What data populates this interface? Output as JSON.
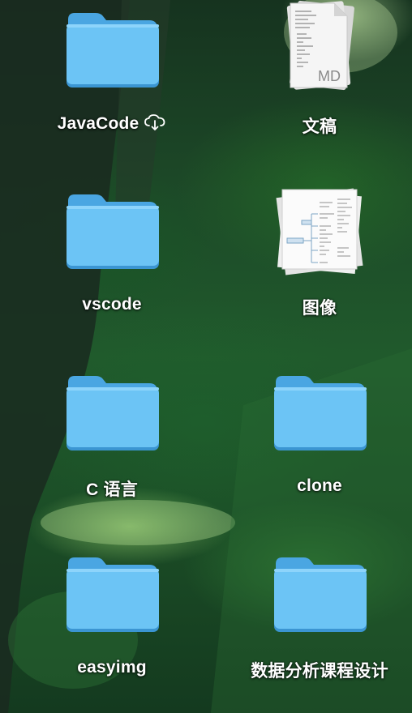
{
  "desktop": {
    "items": [
      {
        "label": "JavaCode",
        "type": "folder",
        "icon": "folder-icon",
        "badge": "cloud-download-icon"
      },
      {
        "label": "文稿",
        "type": "stack",
        "icon": "document-stack-icon",
        "thumb_text": "MD"
      },
      {
        "label": "vscode",
        "type": "folder",
        "icon": "folder-icon"
      },
      {
        "label": "图像",
        "type": "stack",
        "icon": "image-stack-icon"
      },
      {
        "label": "C 语言",
        "type": "folder",
        "icon": "folder-icon"
      },
      {
        "label": "clone",
        "type": "folder",
        "icon": "folder-icon"
      },
      {
        "label": "easyimg",
        "type": "folder",
        "icon": "folder-icon"
      },
      {
        "label": "数据分析课程设计",
        "type": "folder",
        "icon": "folder-icon"
      }
    ]
  },
  "colors": {
    "folder_body": "#6cc4f5",
    "folder_tab": "#4aa6e2",
    "folder_edge": "#3b95d2",
    "label_text": "#ffffff"
  }
}
